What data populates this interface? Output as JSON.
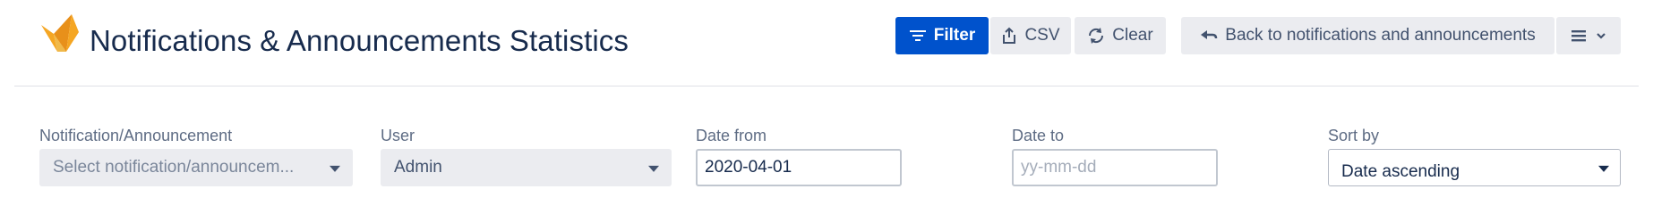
{
  "header": {
    "title": "Notifications & Announcements Statistics",
    "logo_icon": "origami-bird-icon",
    "accent_color": "#0052cc",
    "logo_colors": [
      "#f5a623",
      "#e8901a"
    ]
  },
  "toolbar": {
    "filter_label": "Filter",
    "csv_label": "CSV",
    "clear_label": "Clear",
    "back_label": "Back to notifications and announcements",
    "filter_icon": "filter-icon",
    "csv_icon": "export-icon",
    "clear_icon": "refresh-icon",
    "back_icon": "back-arrow-icon",
    "menu_icon": "hamburger-menu-icon"
  },
  "filters": {
    "notification": {
      "label": "Notification/Announcement",
      "placeholder": "Select notification/announcem..."
    },
    "user": {
      "label": "User",
      "value": "Admin"
    },
    "date_from": {
      "label": "Date from",
      "value": "2020-04-01"
    },
    "date_to": {
      "label": "Date to",
      "placeholder": "yy-mm-dd"
    },
    "sort_by": {
      "label": "Sort by",
      "value": "Date ascending"
    }
  }
}
